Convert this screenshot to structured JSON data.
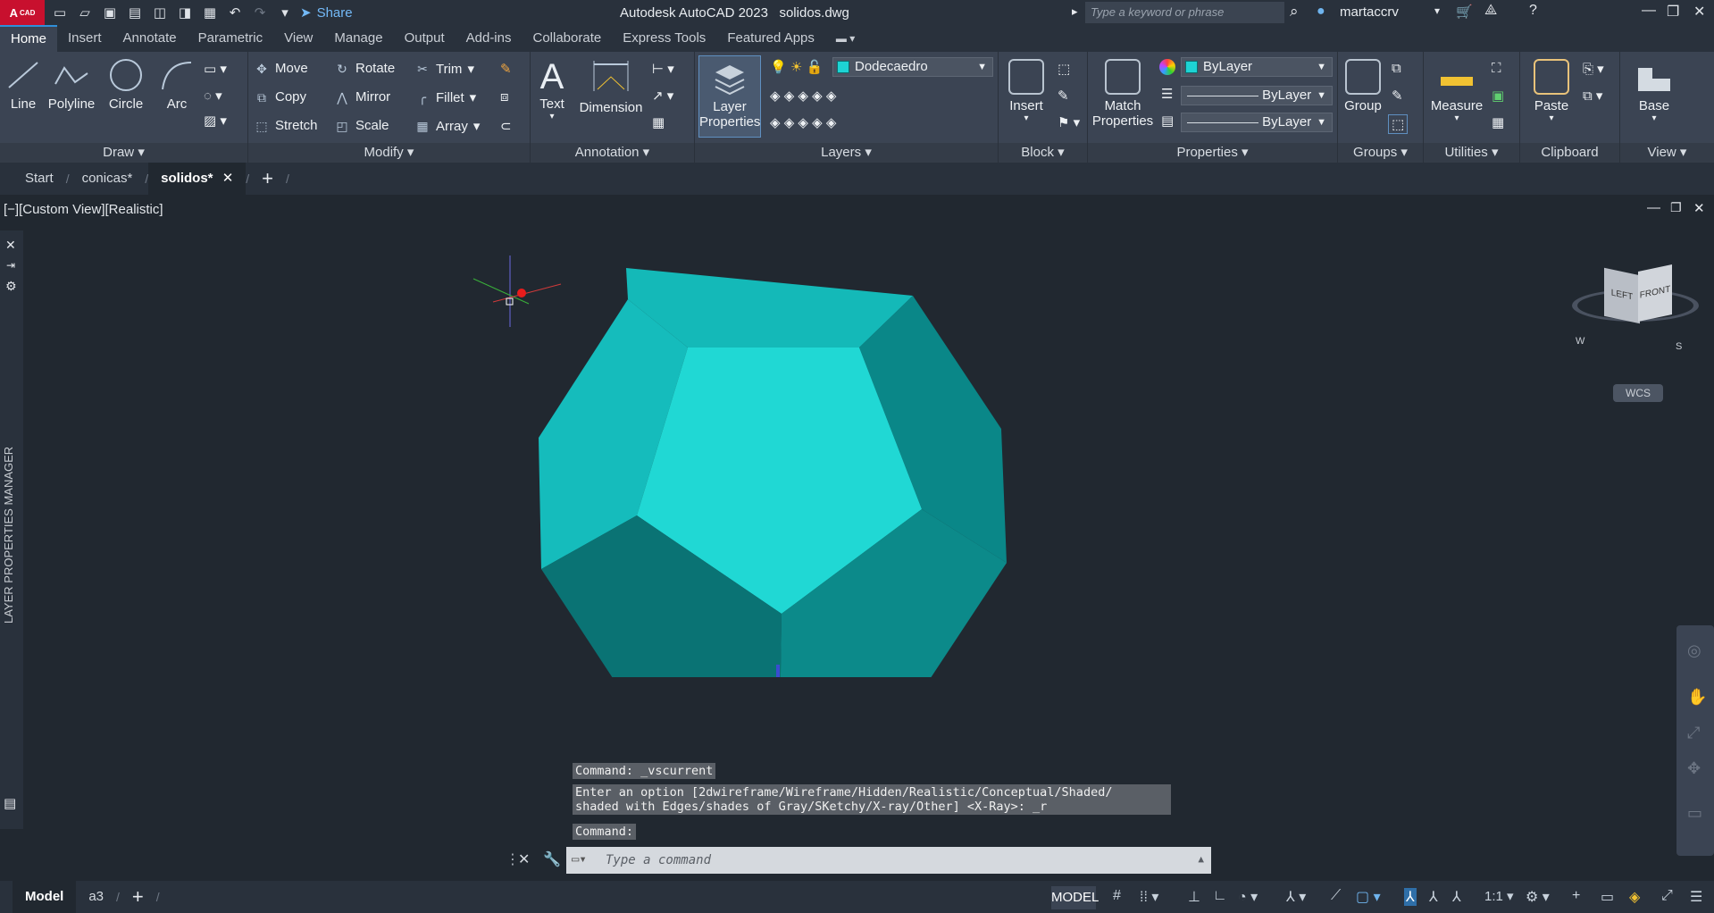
{
  "app": {
    "logo_text": "A",
    "logo_sub": "CAD",
    "title": "Autodesk AutoCAD 2023",
    "file": "solidos.dwg",
    "share_label": "Share",
    "search_placeholder": "Type a keyword or phrase",
    "user": "martaccrv"
  },
  "ribbon_tabs": [
    "Home",
    "Insert",
    "Annotate",
    "Parametric",
    "View",
    "Manage",
    "Output",
    "Add-ins",
    "Collaborate",
    "Express Tools",
    "Featured Apps"
  ],
  "panels": {
    "draw": {
      "label": "Draw",
      "line": "Line",
      "polyline": "Polyline",
      "circle": "Circle",
      "arc": "Arc"
    },
    "modify": {
      "label": "Modify",
      "move": "Move",
      "rotate": "Rotate",
      "trim": "Trim",
      "copy": "Copy",
      "mirror": "Mirror",
      "fillet": "Fillet",
      "stretch": "Stretch",
      "scale": "Scale",
      "array": "Array"
    },
    "annotation": {
      "label": "Annotation",
      "text": "Text",
      "dimension": "Dimension"
    },
    "layers": {
      "label": "Layers",
      "layer_properties_1": "Layer",
      "layer_properties_2": "Properties",
      "current_layer": "Dodecaedro"
    },
    "block": {
      "label": "Block",
      "insert": "Insert"
    },
    "properties": {
      "label": "Properties",
      "match_1": "Match",
      "match_2": "Properties",
      "color": "ByLayer",
      "linetype": "ByLayer",
      "lineweight": "ByLayer"
    },
    "groups": {
      "label": "Groups",
      "group": "Group"
    },
    "utilities": {
      "label": "Utilities",
      "measure": "Measure"
    },
    "clipboard": {
      "label": "Clipboard",
      "paste": "Paste"
    },
    "view": {
      "label": "View",
      "base": "Base"
    }
  },
  "doc_tabs": [
    "Start",
    "conicas*",
    "solidos*"
  ],
  "viewport": {
    "label": "[−][Custom View][Realistic]",
    "side_panel": "LAYER PROPERTIES MANAGER",
    "viewcube_left": "LEFT",
    "viewcube_front": "FRONT",
    "wcs": "WCS",
    "compass_w": "W",
    "compass_s": "S"
  },
  "command": {
    "line1": "Command: _vscurrent",
    "line2": "Enter an option [2dwireframe/Wireframe/Hidden/Realistic/Conceptual/Shaded/",
    "line3": "shaded with Edges/shades of Gray/SKetchy/X-ray/Other] <X-Ray>: _r",
    "line4": "Command:",
    "placeholder": "Type a command"
  },
  "status": {
    "tabs": [
      "Model",
      "a3"
    ],
    "model_button": "MODEL",
    "scale": "1:1"
  },
  "colors": {
    "accent": "#2f8fd8",
    "face_light": "#20d8d4",
    "face_mid": "#14b9b8",
    "face_dark": "#0a7f80"
  }
}
